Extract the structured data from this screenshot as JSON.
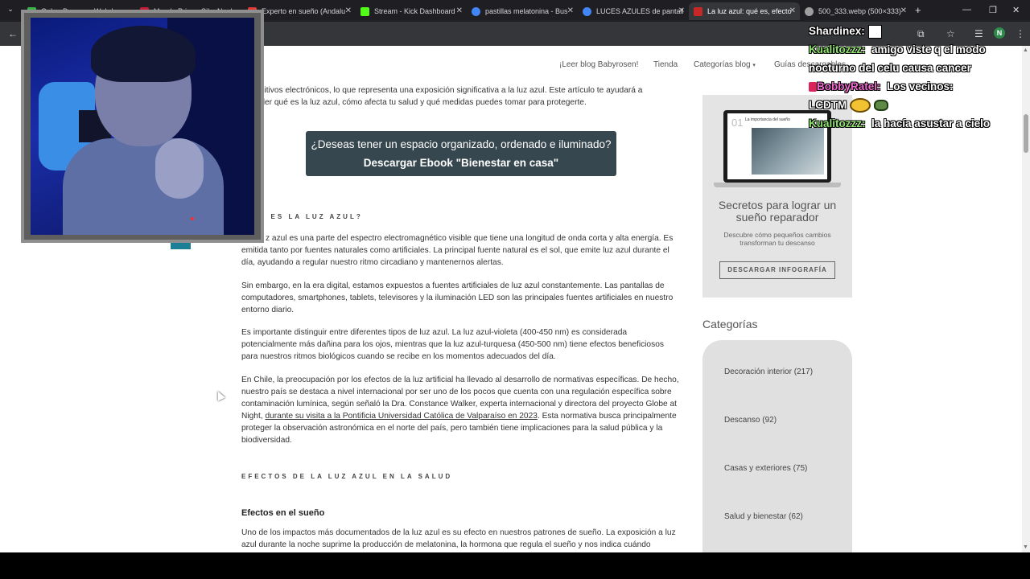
{
  "browser": {
    "tabs": [
      {
        "title": "Ooh... Doome... Webd...",
        "color": "#3bb44a"
      },
      {
        "title": "Mundo Primer Sil... Naples...",
        "color": "#c71d3a"
      },
      {
        "title": "Experto en sueño (Andalu",
        "color": "#e53935"
      },
      {
        "title": "Stream - Kick Dashboard",
        "color": "#53fc18"
      },
      {
        "title": "pastillas melatonina - Bus",
        "color": "#4285f4"
      },
      {
        "title": "LUCES AZULES de pantall",
        "color": "#4285f4"
      },
      {
        "title": "La luz azul: qué es, efecto",
        "color": "#c62828"
      },
      {
        "title": "500_333.webp (500×333)",
        "color": "#9e9e9e"
      }
    ],
    "profile_initial": "N"
  },
  "nav": {
    "items": [
      "¡Leer blog Babyrosen!",
      "Tienda",
      "Categorías blog",
      "Guías descargables"
    ]
  },
  "article": {
    "intro_tail": "positivos electrónicos, lo que representa una exposición significativa a la luz azul. Este artículo te ayudará a\nender qué es la luz azul, cómo afecta tu salud y qué medidas puedes tomar para protegerte.",
    "cta_line1": "¿Deseas tener un espacio organizado, ordenado e iluminado?",
    "cta_line2": "Descargar Ebook \"Bienestar en casa\"",
    "section1": "É ES LA LUZ AZUL?",
    "p1": "z azul es una parte del espectro electromagnético visible que tiene una longitud de onda corta y alta energía. Es emitida tanto por fuentes naturales como artificiales. La principal fuente natural es el sol, que emite luz azul durante el día, ayudando a regular nuestro ritmo circadiano y mantenernos alertas.",
    "p2": "Sin embargo, en la era digital, estamos expuestos a fuentes artificiales de luz azul constantemente. Las pantallas de computadores, smartphones, tablets, televisores y la iluminación LED son las principales fuentes artificiales en nuestro entorno diario.",
    "p3": "Es importante distinguir entre diferentes tipos de luz azul. La luz azul-violeta (400-450 nm) es considerada potencialmente más dañina para los ojos, mientras que la luz azul-turquesa (450-500 nm) tiene efectos beneficiosos para nuestros ritmos biológicos cuando se recibe en los momentos adecuados del día.",
    "p4_a": "En Chile, la preocupación por los efectos de la luz artificial ha llevado al desarrollo de normativas específicas. De hecho, nuestro país se destaca a nivel internacional por ser uno de los pocos que cuenta con una regulación específica sobre contaminación lumínica, según señaló la Dra. Constance Walker, experta internacional y directora del proyecto Globe at Night, ",
    "p4_link": "durante su visita a la Pontificia Universidad Católica de Valparaíso en 2023",
    "p4_b": ". Esta normativa busca principalmente proteger la observación astronómica en el norte del país, pero también tiene implicaciones para la salud pública y la biodiversidad.",
    "section2": "EFECTOS DE LA LUZ AZUL EN LA SALUD",
    "subheading": "Efectos en el sueño",
    "p5": "Uno de los impactos más documentados de la luz azul es su efecto en nuestros patrones de sueño. La exposición a luz azul durante la noche suprime la producción de melatonina, la hormona que regula el sueño y nos indica cuándo"
  },
  "sidebar": {
    "laptop_num": "01",
    "laptop_title": "La importancia del sueño",
    "promo_title": "Secretos para lograr un sueño reparador",
    "promo_sub": "Descubre cómo pequeños cambios transforman tu descanso",
    "promo_button": "DESCARGAR INFOGRAFÍA",
    "categories_title": "Categorías",
    "categories": [
      "Decoración interior (217)",
      "Descanso (92)",
      "Casas y exteriores (75)",
      "Salud y bienestar (62)"
    ]
  },
  "chat": {
    "user1": "Shardinex:",
    "user2": "Kualitozzz:",
    "msg2a": "amigo viste q el modo",
    "msg2b": "nocturno del celu causa cancer",
    "user3": "BobbyRatel:",
    "msg3a": "Los vecinos:",
    "msg3b": "LCDTM",
    "user4": "Kualitozzz:",
    "msg4": "la hacía asustar a cielo"
  }
}
